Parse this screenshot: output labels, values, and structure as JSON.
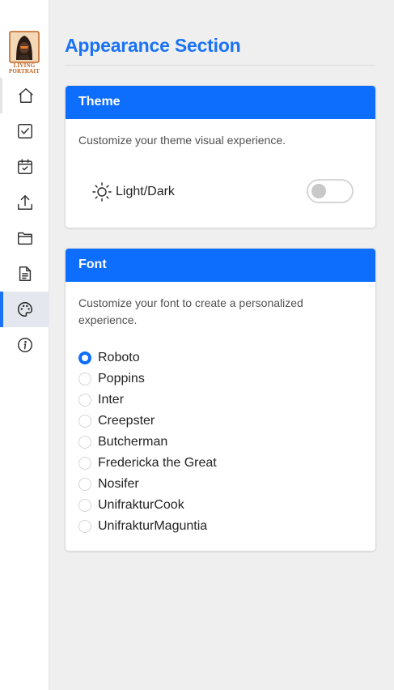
{
  "logo": {
    "line1": "LIVING",
    "line2": "PORTRAIT"
  },
  "nav": [
    {
      "name": "home",
      "icon": "home-icon"
    },
    {
      "name": "tasks",
      "icon": "checkbox-icon"
    },
    {
      "name": "calendar",
      "icon": "calendar-icon"
    },
    {
      "name": "upload",
      "icon": "upload-icon"
    },
    {
      "name": "folder",
      "icon": "folder-icon"
    },
    {
      "name": "document",
      "icon": "document-icon"
    },
    {
      "name": "appearance",
      "icon": "palette-icon",
      "active": true
    },
    {
      "name": "info",
      "icon": "info-icon"
    }
  ],
  "page": {
    "title": "Appearance Section"
  },
  "theme": {
    "header": "Theme",
    "description": "Customize your theme visual experience.",
    "toggle_label": "Light/Dark",
    "toggle_on": false
  },
  "font": {
    "header": "Font",
    "description": "Customize your font to create a personalized experience.",
    "selected": "Roboto",
    "options": [
      "Roboto",
      "Poppins",
      "Inter",
      "Creepster",
      "Butcherman",
      "Fredericka the Great",
      "Nosifer",
      "UnifrakturCook",
      "UnifrakturMaguntia"
    ]
  },
  "colors": {
    "accent": "#1a73f5",
    "header": "#0d6efd"
  }
}
